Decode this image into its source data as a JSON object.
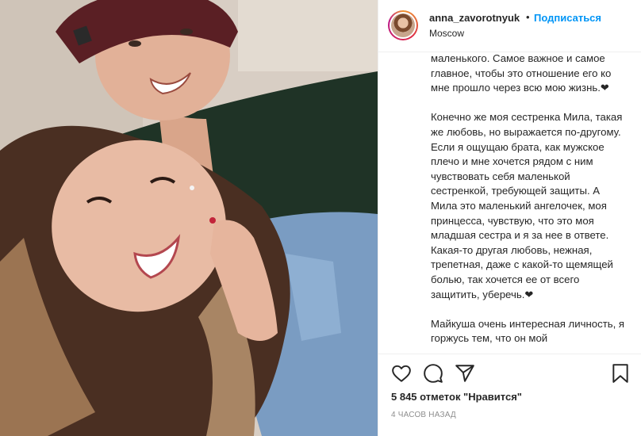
{
  "photo": {
    "alt": "selfie"
  },
  "header": {
    "username": "anna_zavorotnyuk",
    "separator": "•",
    "follow_label": "Подписаться",
    "location": "Moscow"
  },
  "caption": {
    "paragraphs": [
      "маленького. Самое важное и самое главное, чтобы это отношение его ко мне прошло через всю мою жизнь.❤",
      "Конечно же моя сестренка Мила, такая же любовь, но выражается по-другому. Если я ощущаю брата, как мужское плечо и мне хочется рядом с ним чувствовать себя маленькой сестренкой, требующей защиты. А Мила это маленький ангелочек, моя принцесса, чувствую, что это моя младшая сестра и я за нее в ответе. Какая-то другая любовь, нежная, трепетная, даже с какой-то щемящей болью, так хочется ее от всего защитить, уберечь.❤",
      "Майкуша очень интересная личность, я горжусь тем, что он мой"
    ]
  },
  "actions": {
    "icons": [
      "heart-icon",
      "comment-icon",
      "share-icon",
      "bookmark-icon"
    ],
    "likes_text": "5 845 отметок \"Нравится\"",
    "time_text": "4 ЧАСОВ НАЗАД"
  }
}
